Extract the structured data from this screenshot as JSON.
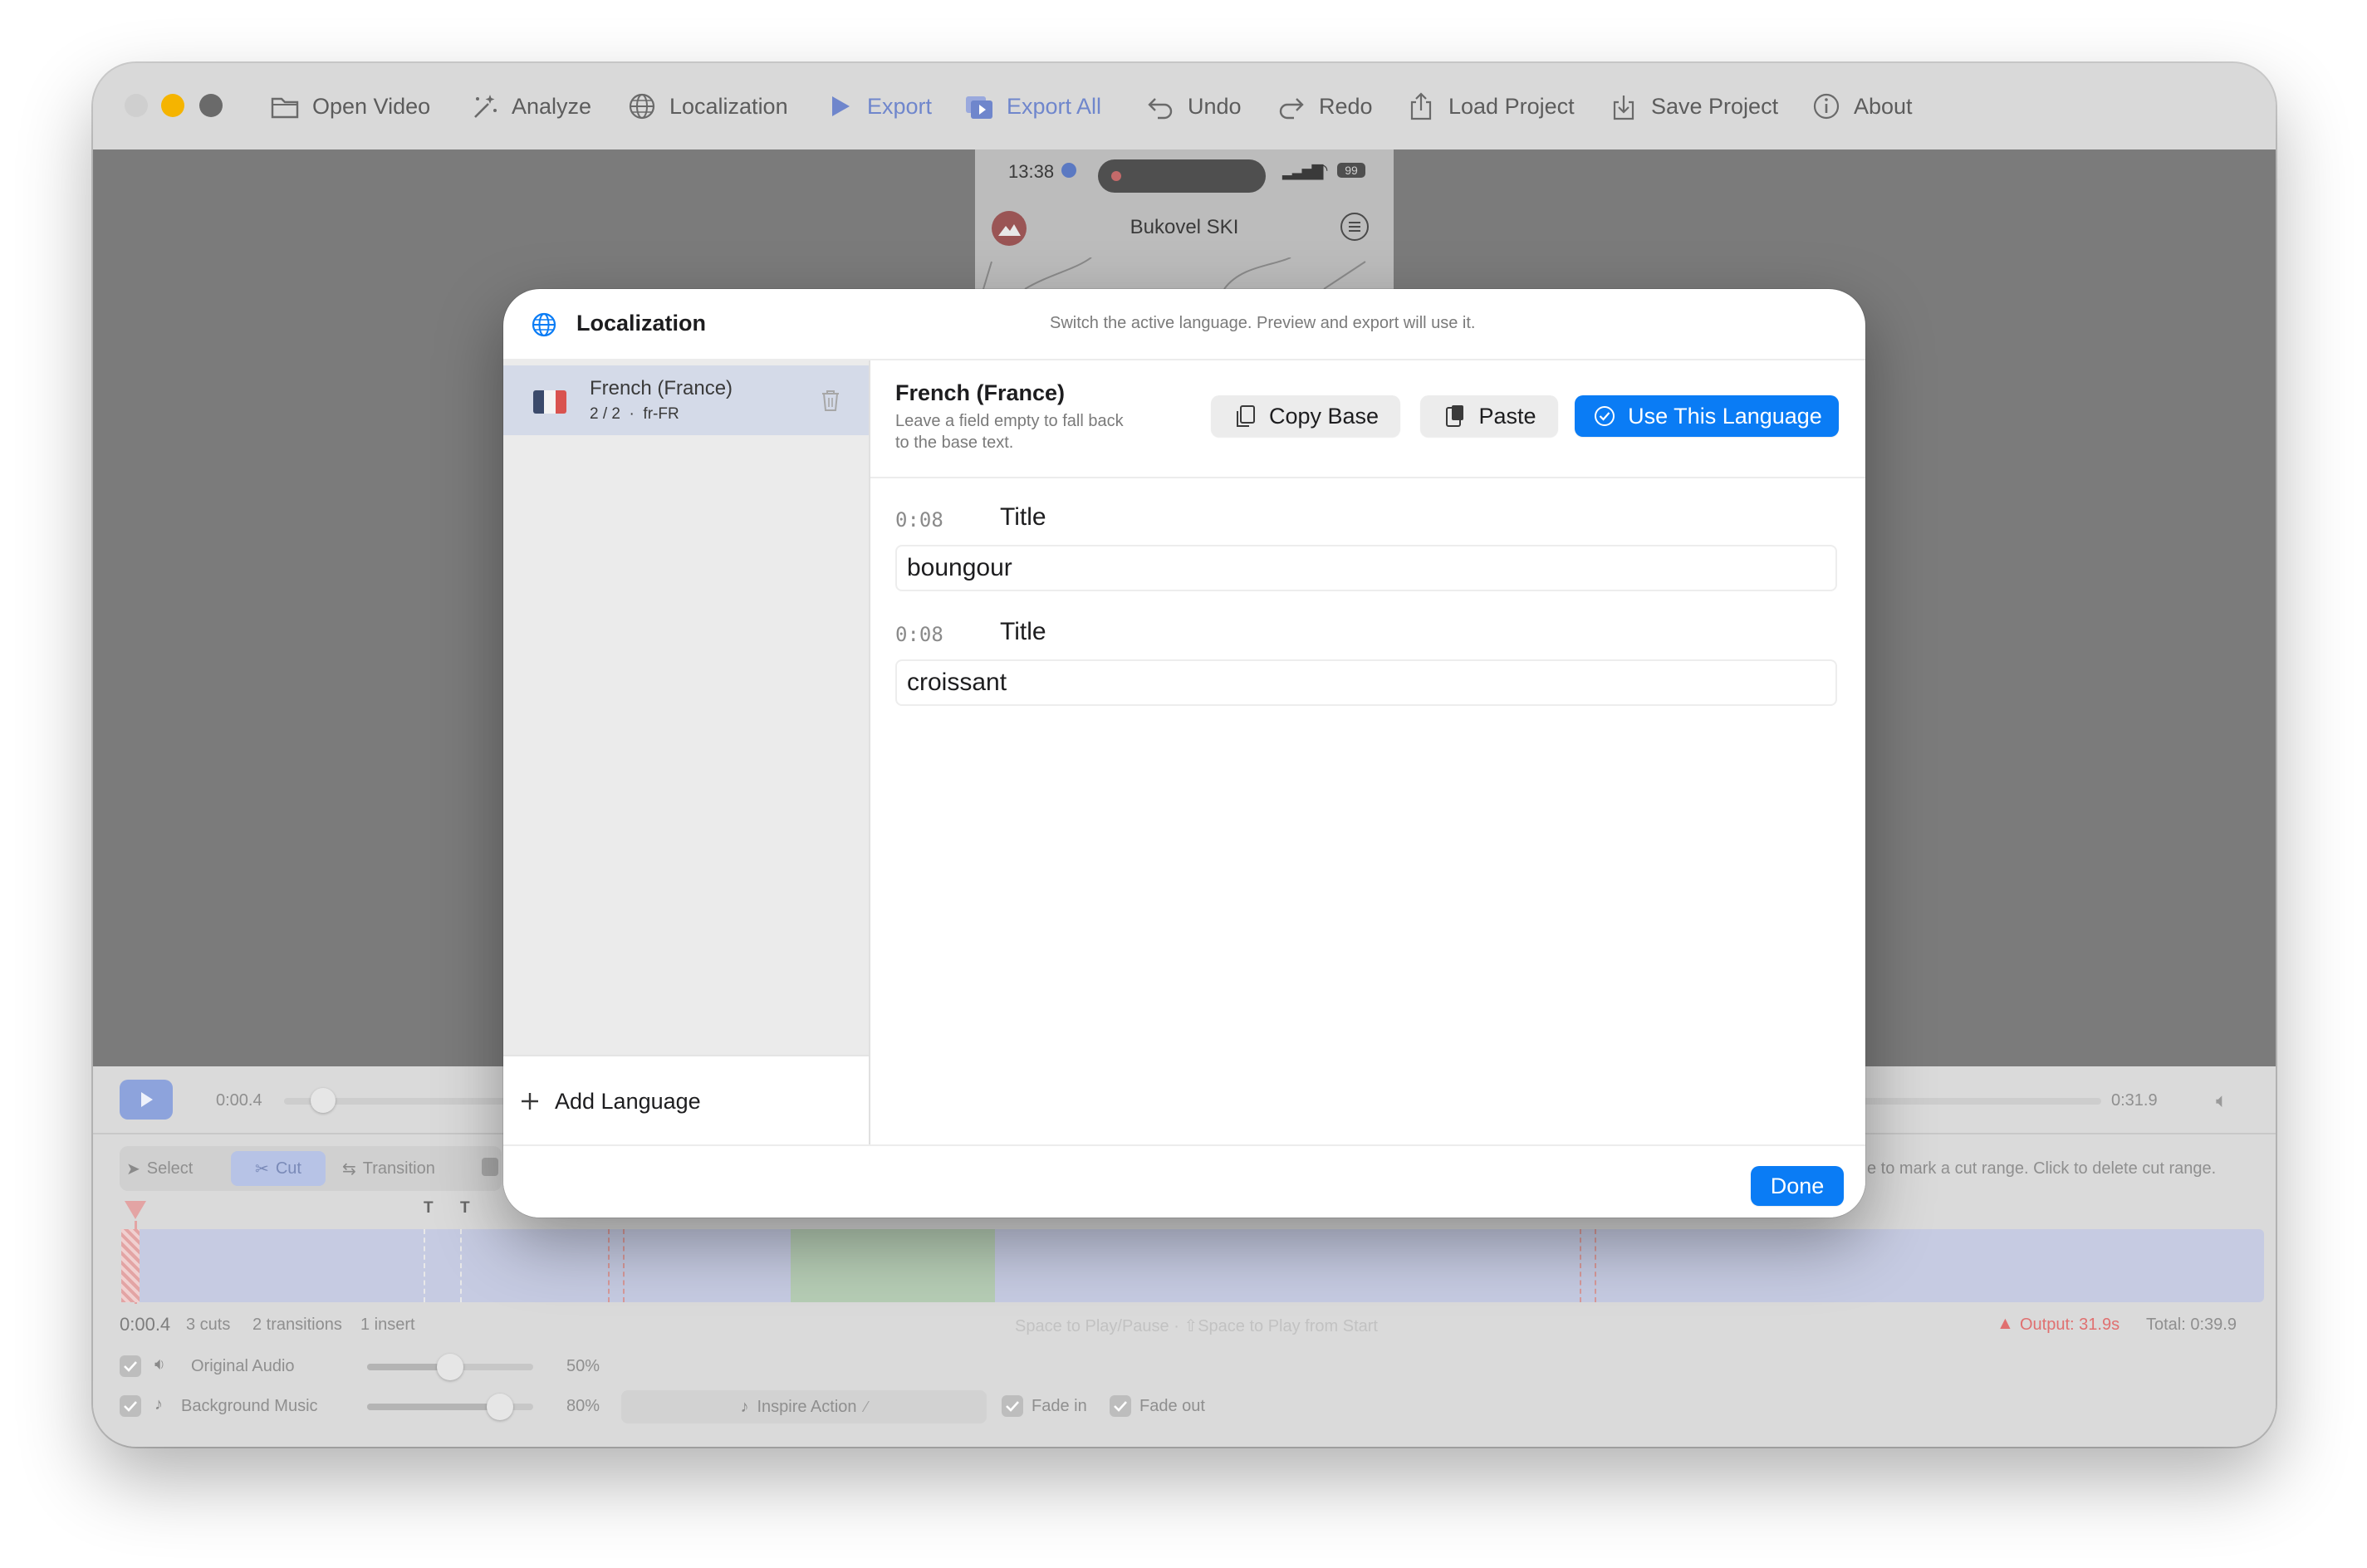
{
  "toolbar": {
    "open_video": "Open Video",
    "analyze": "Analyze",
    "localization": "Localization",
    "export": "Export",
    "export_all": "Export All",
    "undo": "Undo",
    "redo": "Redo",
    "load_project": "Load Project",
    "save_project": "Save Project",
    "about": "About"
  },
  "phone_preview": {
    "time": "13:38",
    "battery": "99",
    "app_title": "Bukovel SKI"
  },
  "player": {
    "current_time": "0:00.4",
    "end_time": "0:31.9"
  },
  "editor_tools": {
    "select": "Select",
    "cut": "Cut",
    "transition": "Transition",
    "hint": "e to mark a cut range. Click to delete cut range."
  },
  "timeline": {
    "marker_1": "T",
    "marker_2": "T"
  },
  "status": {
    "time": "0:00.4",
    "cuts": "3 cuts",
    "transitions": "2 transitions",
    "inserts": "1 insert",
    "shortcuts": "Space to Play/Pause · ⇧Space to Play from Start",
    "output": "Output: 31.9s",
    "total": "Total: 0:39.9"
  },
  "audio": {
    "original_label": "Original Audio",
    "original_volume": "50%",
    "original_level": 0.5,
    "music_label": "Background Music",
    "music_volume": "80%",
    "music_level": 0.8,
    "track_name": "Inspire Action",
    "fade_in": "Fade in",
    "fade_out": "Fade out"
  },
  "modal": {
    "title": "Localization",
    "subtitle": "Switch the active language. Preview and export will use it.",
    "languages": [
      {
        "name": "French (France)",
        "meta": "2 / 2  ·  fr-FR"
      }
    ],
    "add_language": "Add Language",
    "detail": {
      "title": "French (France)",
      "hint_line1": "Leave a field empty to fall back",
      "hint_line2": "to the base text.",
      "copy_base": "Copy Base",
      "paste": "Paste",
      "use_language": "Use This Language"
    },
    "entries": [
      {
        "time": "0:08",
        "label": "Title",
        "value": "boungour"
      },
      {
        "time": "0:08",
        "label": "Title",
        "value": "croissant"
      }
    ],
    "done": "Done"
  },
  "colors": {
    "accent": "#0a7cf5",
    "toolbar_blue": "#6f86cc",
    "traffic_yellow": "#f5b400",
    "output_red": "#e07070"
  }
}
